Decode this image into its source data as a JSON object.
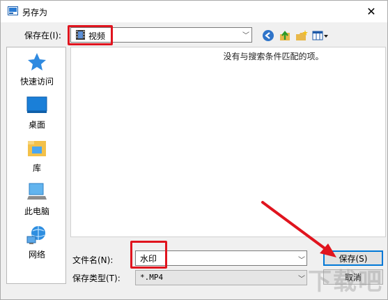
{
  "window": {
    "title": "另存为",
    "close_glyph": "✕"
  },
  "toolbar": {
    "save_in_label": "保存在(I):",
    "folder_value": "视频",
    "icons": [
      "back-icon",
      "up-folder-icon",
      "new-folder-icon",
      "view-menu-icon"
    ]
  },
  "places": [
    {
      "label": "快速访问",
      "icon": "star-icon"
    },
    {
      "label": "桌面",
      "icon": "desktop-icon"
    },
    {
      "label": "库",
      "icon": "library-icon"
    },
    {
      "label": "此电脑",
      "icon": "computer-icon"
    },
    {
      "label": "网络",
      "icon": "network-icon"
    }
  ],
  "filelist": {
    "empty_message": "没有与搜索条件匹配的项。"
  },
  "form": {
    "filename_label": "文件名(N):",
    "filename_value": "水印",
    "filetype_label": "保存类型(T):",
    "filetype_value": "*.MP4"
  },
  "buttons": {
    "save": "保存(S)",
    "cancel": "取消"
  },
  "annotations": {
    "color": "#e0141e"
  },
  "watermark": "下载吧"
}
